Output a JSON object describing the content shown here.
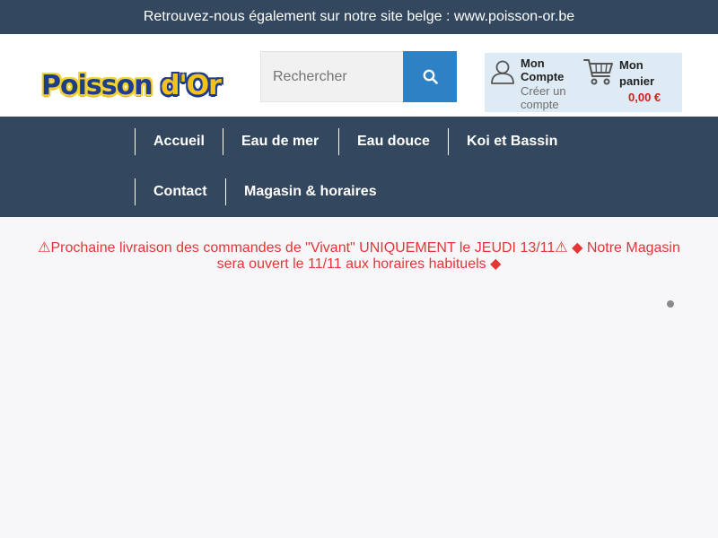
{
  "top_banner": {
    "text": "Retrouvez-nous également sur notre site belge : www.poisson-or.be"
  },
  "header": {
    "logo": {
      "part1": "Poisson ",
      "part2": "d'Or"
    },
    "search": {
      "placeholder": "Rechercher",
      "icon": "search-icon"
    },
    "account": {
      "title": "Mon Compte",
      "subtitle": "Créer un compte",
      "icon": "user-icon"
    },
    "cart": {
      "title": "Mon panier",
      "total": "0,00 €",
      "icon": "shopping-cart-icon"
    }
  },
  "nav": {
    "items": [
      {
        "label": "Accueil"
      },
      {
        "label": "Eau de mer"
      },
      {
        "label": "Eau douce"
      },
      {
        "label": "Koi et Bassin"
      },
      {
        "label": "Contact"
      },
      {
        "label": "Magasin & horaires"
      }
    ]
  },
  "notice": {
    "text": "⚠Prochaine livraison des commandes de \"Vivant\" UNIQUEMENT le JEUDI 13/11⚠ ◆ Notre Magasin sera ouvert le 11/11 aux horaires habituels ◆"
  },
  "colors": {
    "nav_background": "#33475e",
    "search_button": "#2c82c4",
    "account_panel": "#deebf5",
    "notice_text": "#e53535",
    "price": "#d41c1c"
  }
}
